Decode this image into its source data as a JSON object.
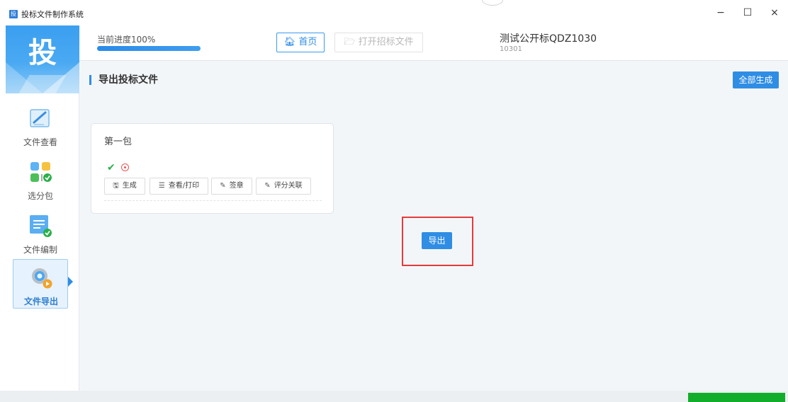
{
  "window": {
    "title": "投标文件制作系统",
    "icon_char": "投",
    "controls": {
      "minimize": "−",
      "maximize": "☐",
      "close": "×"
    }
  },
  "sidebar": {
    "logo": "投",
    "items": [
      {
        "label": "文件查看",
        "icon": "document-edit-icon",
        "active": false
      },
      {
        "label": "选分包",
        "icon": "package-select-icon",
        "active": false
      },
      {
        "label": "文件编制",
        "icon": "file-compile-icon",
        "active": false
      },
      {
        "label": "文件导出",
        "icon": "gear-export-icon",
        "active": true
      }
    ]
  },
  "header": {
    "progress_label": "当前进度100%",
    "progress_fraction": 1.0,
    "home_button": "首页",
    "open_button": "打开招标文件",
    "project_name": "测试公开标QDZ1030",
    "project_code": "10301"
  },
  "main": {
    "section_title": "导出投标文件",
    "generate_all_button": "全部生成",
    "package": {
      "title": "第一包",
      "status_icons": [
        "check-icon",
        "record-icon"
      ],
      "buttons": [
        {
          "label": "生成",
          "icon": "save-icon"
        },
        {
          "label": "查看/打印",
          "icon": "list-icon"
        },
        {
          "label": "签章",
          "icon": "edit-icon"
        },
        {
          "label": "评分关联",
          "icon": "edit-icon"
        }
      ]
    },
    "export_button": "导出"
  },
  "colors": {
    "accent": "#2f8de4",
    "highlight_border": "#e53b3b",
    "status_green": "#12ad2b"
  }
}
